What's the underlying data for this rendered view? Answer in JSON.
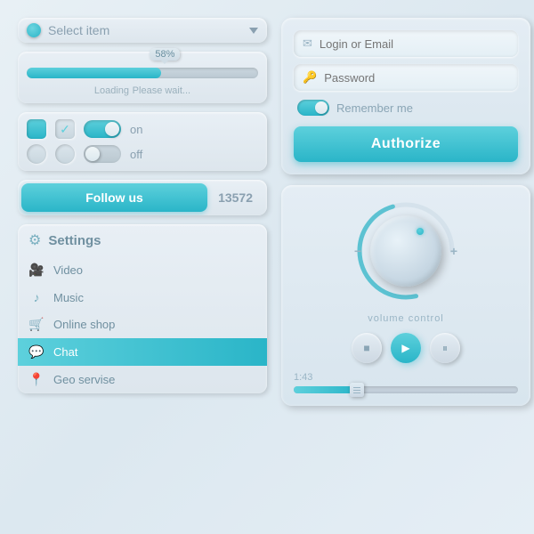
{
  "select": {
    "placeholder": "Select item"
  },
  "progress": {
    "percent": "58%",
    "loading_label": "Loading",
    "loading_sub": "Please wait...",
    "fill_width": "58%"
  },
  "toggles": {
    "on_label": "on",
    "off_label": "off"
  },
  "follow": {
    "button_label": "Follow us",
    "count": "13572"
  },
  "settings": {
    "title": "Settings",
    "items": [
      {
        "label": "Video",
        "icon": "🎥",
        "active": false
      },
      {
        "label": "Music",
        "icon": "♪",
        "active": false
      },
      {
        "label": "Online shop",
        "icon": "🛒",
        "active": false
      },
      {
        "label": "Chat",
        "icon": "💬",
        "active": true
      },
      {
        "label": "Geo servise",
        "icon": "📍",
        "active": false
      }
    ]
  },
  "login": {
    "email_placeholder": "Login or Email",
    "password_placeholder": "Password",
    "remember_label": "Remember me",
    "authorize_label": "Authorize"
  },
  "volume": {
    "label": "volume control",
    "minus": "−",
    "plus": "+"
  },
  "media": {
    "stop_label": "stop",
    "play_label": "play",
    "pause_label": "pause",
    "time": "1:43"
  }
}
